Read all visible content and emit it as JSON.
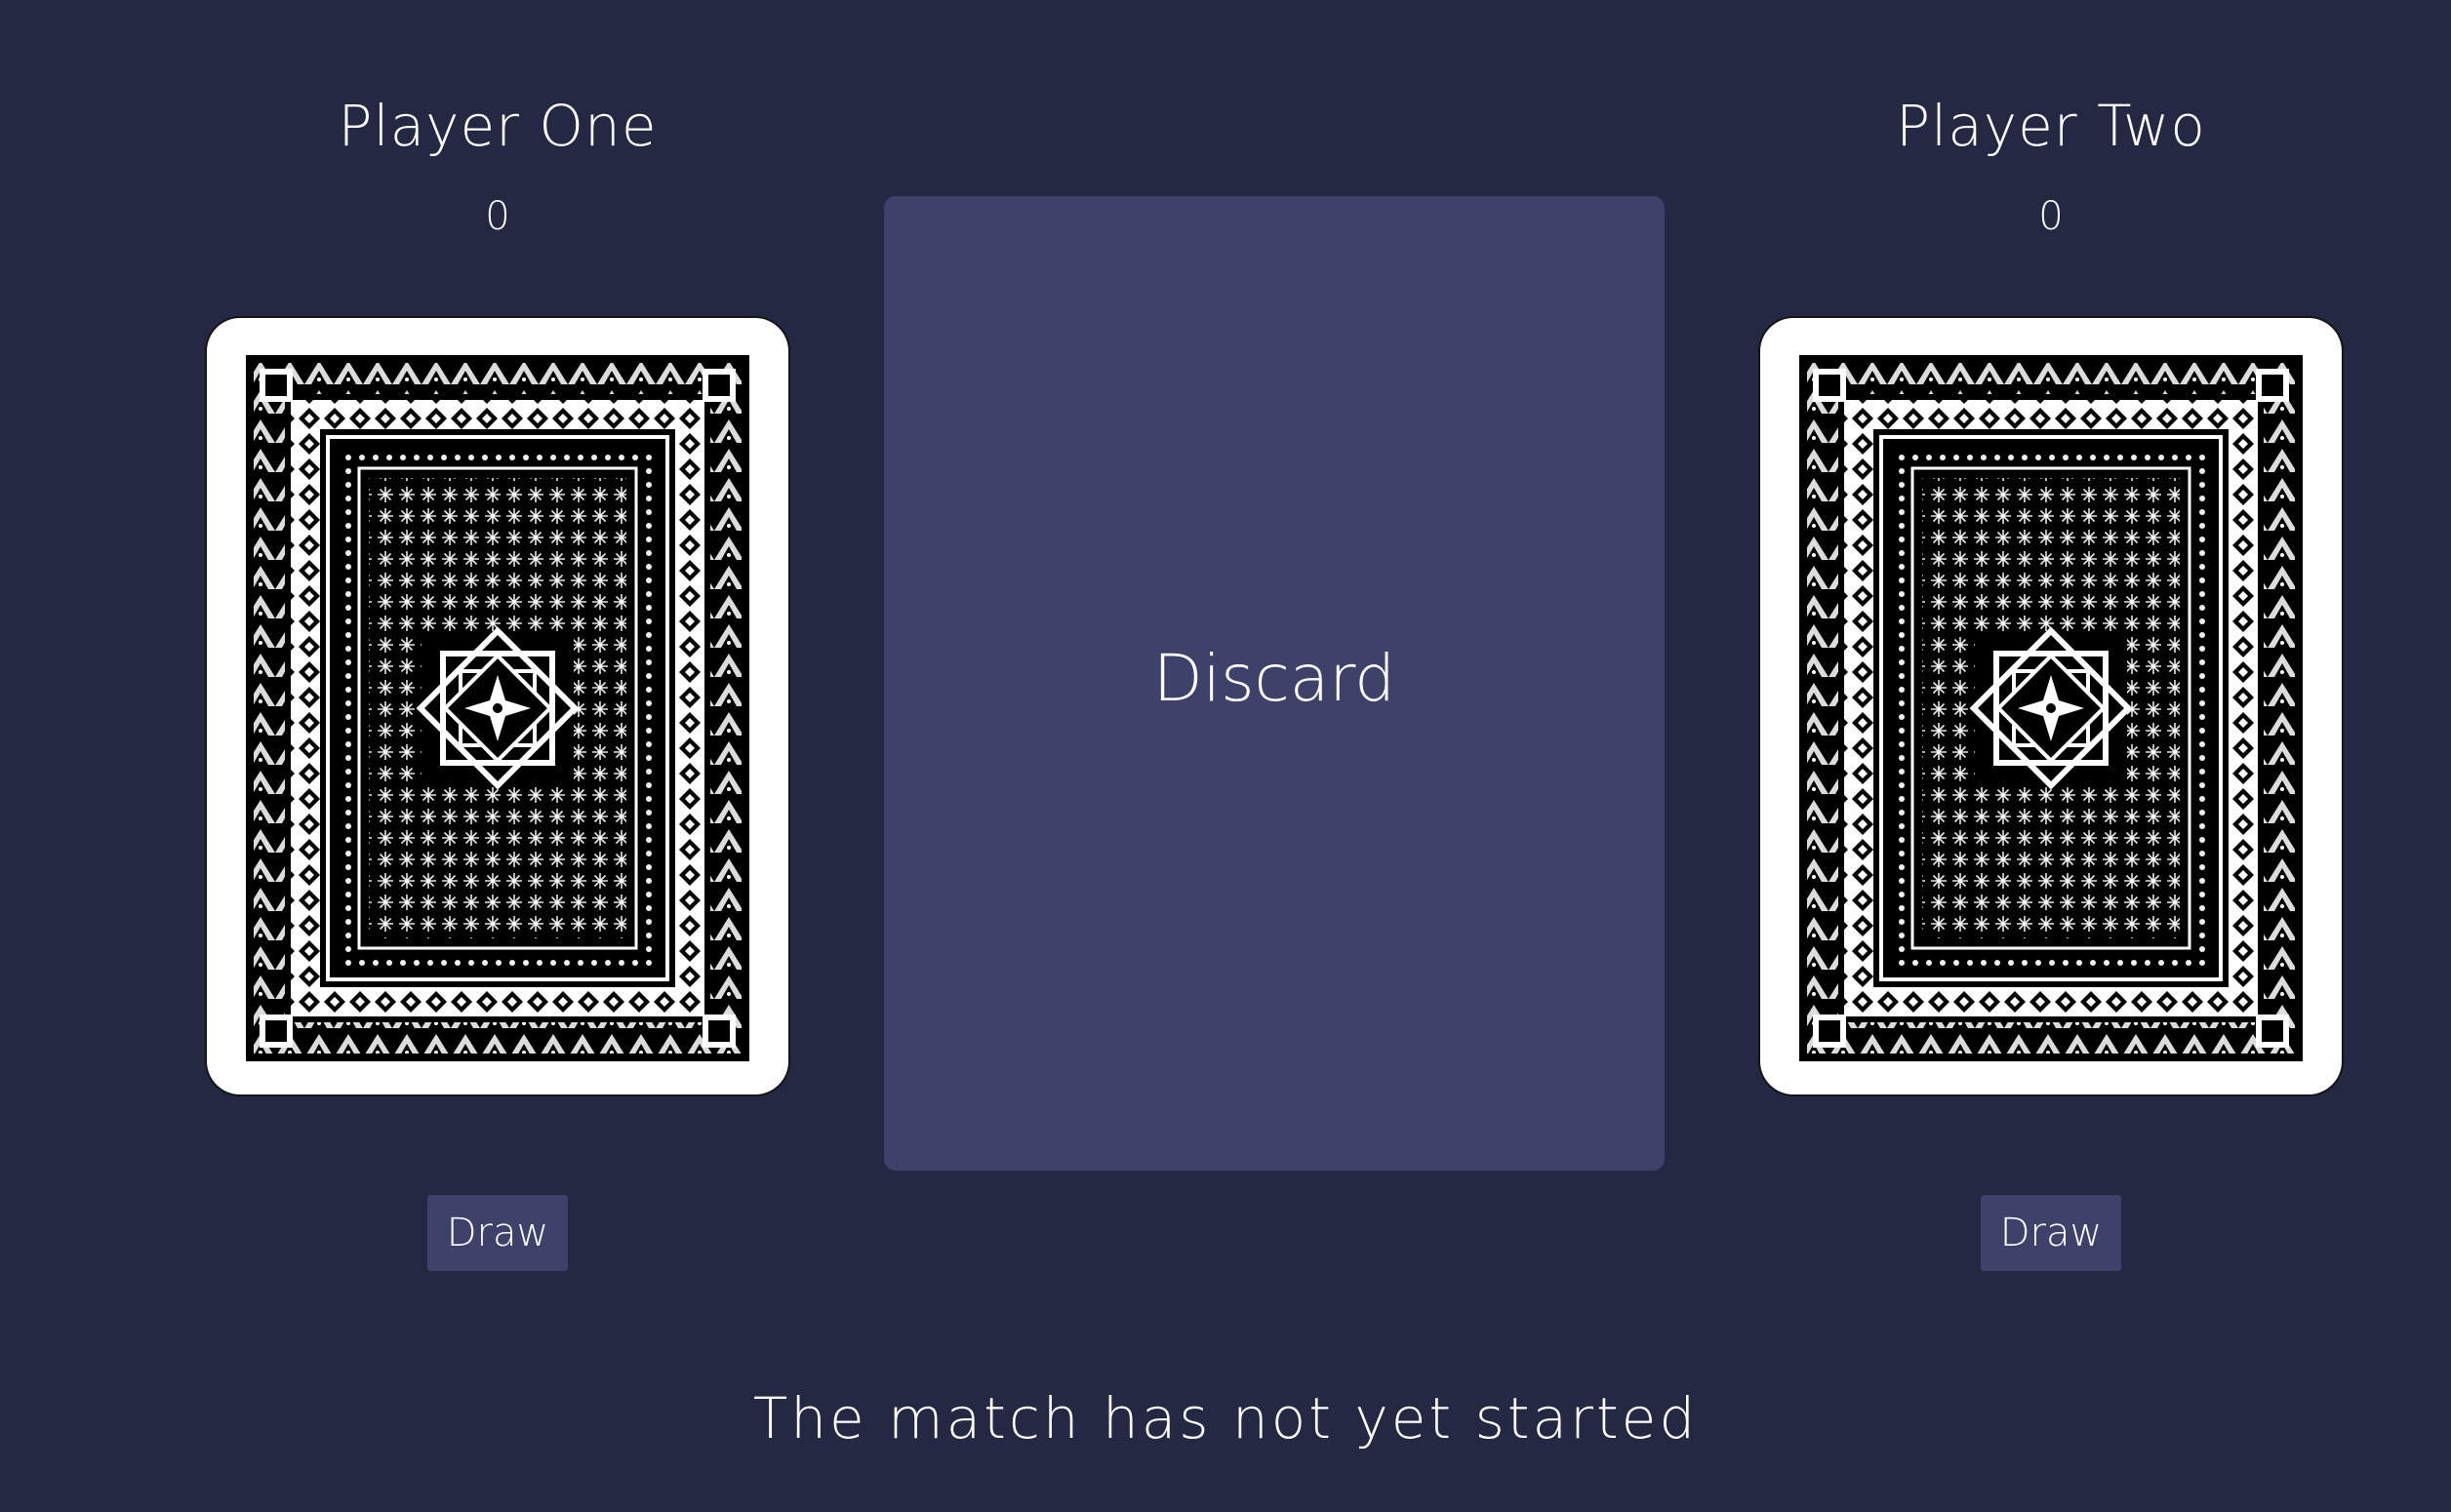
{
  "players": [
    {
      "name": "Player One",
      "score": "0",
      "draw_label": "Draw"
    },
    {
      "name": "Player Two",
      "score": "0",
      "draw_label": "Draw"
    }
  ],
  "discard": {
    "label": "Discard"
  },
  "status": {
    "message": "The match has not yet started"
  },
  "colors": {
    "background": "#252842",
    "panel": "#3e426a",
    "text": "#ffffff",
    "card_face": "#ffffff",
    "card_pattern": "#000000"
  },
  "icons": {
    "deck": "card-back-pattern"
  }
}
